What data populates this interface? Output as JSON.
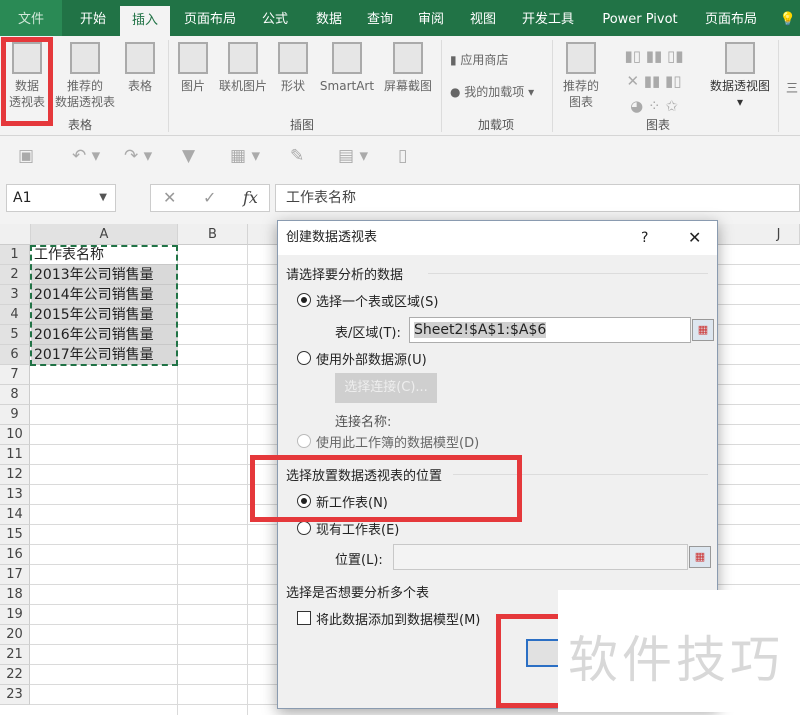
{
  "ribbon_tabs": [
    "文件",
    "开始",
    "插入",
    "页面布局",
    "公式",
    "数据",
    "查询",
    "审阅",
    "视图",
    "开发工具",
    "Power Pivot",
    "页面布局"
  ],
  "active_tab": "插入",
  "ribbon": {
    "pivot": [
      "数据",
      "透视表"
    ],
    "recommended_pivot": [
      "推荐的",
      "数据透视表"
    ],
    "table": "表格",
    "group_tables": "表格",
    "picture": "图片",
    "online_picture": "联机图片",
    "shapes": "形状",
    "smartart": "SmartArt",
    "screenshot": "屏幕截图",
    "group_illustrations": "插图",
    "store": "应用商店",
    "my_addins": "我的加载项",
    "group_addins": "加载项",
    "rec_charts": [
      "推荐的",
      "图表"
    ],
    "pivot_chart": "数据透视图",
    "group_charts": "图表",
    "cut3d": "三"
  },
  "formula_bar": {
    "name_box": "A1",
    "fx": "fx",
    "cancel": "✕",
    "enter": "✓",
    "content": "工作表名称"
  },
  "columns": [
    "A",
    "B",
    "J"
  ],
  "rows": [
    "1",
    "2",
    "3",
    "4",
    "5",
    "6",
    "7",
    "8",
    "9",
    "10",
    "11",
    "12",
    "13",
    "14",
    "15",
    "16",
    "17",
    "18",
    "19",
    "20",
    "21",
    "22",
    "23"
  ],
  "cells": [
    "工作表名称",
    "2013年公司销售量",
    "2014年公司销售量",
    "2015年公司销售量",
    "2016年公司销售量",
    "2017年公司销售量"
  ],
  "dialog": {
    "title": "创建数据透视表",
    "help": "?",
    "close": "✕",
    "section1": "请选择要分析的数据",
    "opt_range": "选择一个表或区域(S)",
    "range_label": "表/区域(T):",
    "range_value": "Sheet2!$A$1:$A$6",
    "opt_external": "使用外部数据源(U)",
    "choose_conn": "选择连接(C)...",
    "conn_name": "连接名称:",
    "opt_model": "使用此工作簿的数据模型(D)",
    "section2": "选择放置数据透视表的位置",
    "opt_new": "新工作表(N)",
    "opt_existing": "现有工作表(E)",
    "location_label": "位置(L):",
    "section3": "选择是否想要分析多个表",
    "add_model": "将此数据添加到数据模型(M)",
    "ok": "确"
  },
  "watermark": "软件技巧",
  "colors": {
    "excel_green": "#217346",
    "highlight_red": "#e5383b"
  }
}
